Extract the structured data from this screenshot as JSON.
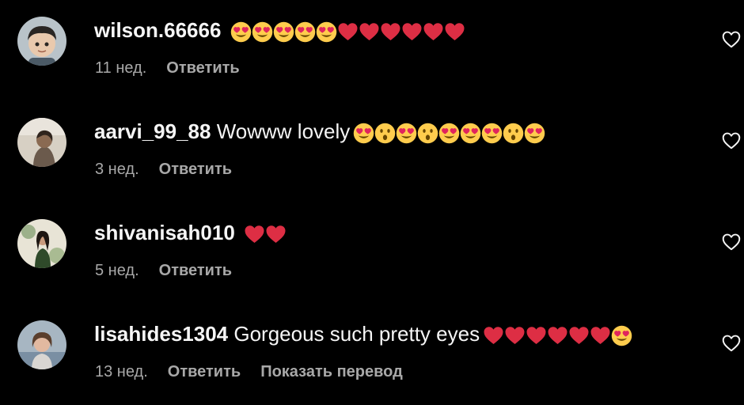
{
  "like_icon": "heart-outline-icon",
  "colors": {
    "background": "#000000",
    "primary_text": "#f5f5f5",
    "secondary_text": "#a8a8a8"
  },
  "comments": [
    {
      "username": "wilson.66666",
      "text": "",
      "emojis": [
        "heart-eyes",
        "heart-eyes",
        "heart-eyes",
        "heart-eyes",
        "heart-eyes",
        "red-heart",
        "red-heart",
        "red-heart",
        "red-heart",
        "red-heart",
        "red-heart"
      ],
      "time": "11 нед.",
      "reply": "Ответить",
      "translate": ""
    },
    {
      "username": "aarvi_99_88",
      "text": "Wowww lovely",
      "emojis": [
        "heart-eyes",
        "surprised",
        "heart-eyes",
        "surprised",
        "heart-eyes",
        "heart-eyes",
        "heart-eyes",
        "surprised",
        "heart-eyes"
      ],
      "time": "3 нед.",
      "reply": "Ответить",
      "translate": ""
    },
    {
      "username": "shivanisah010",
      "text": "",
      "emojis": [
        "red-heart",
        "red-heart"
      ],
      "time": "5 нед.",
      "reply": "Ответить",
      "translate": ""
    },
    {
      "username": "lisahides1304",
      "text": "Gorgeous such pretty eyes",
      "emojis": [
        "red-heart",
        "red-heart",
        "red-heart",
        "red-heart",
        "red-heart",
        "red-heart",
        "heart-eyes"
      ],
      "time": "13 нед.",
      "reply": "Ответить",
      "translate": "Показать перевод"
    }
  ]
}
